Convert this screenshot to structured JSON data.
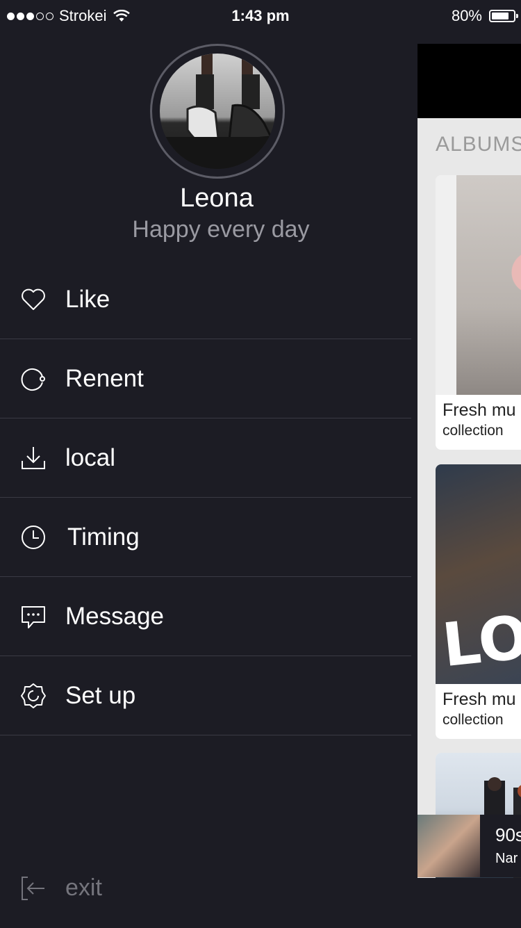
{
  "status_bar": {
    "carrier": "Strokei",
    "time": "1:43 pm",
    "battery_text": "80%",
    "battery_level": 0.8
  },
  "profile": {
    "name": "Leona",
    "status": "Happy every day"
  },
  "menu": {
    "items": [
      {
        "label": "Like",
        "icon": "heart-icon"
      },
      {
        "label": "Renent",
        "icon": "refresh-icon"
      },
      {
        "label": "local",
        "icon": "download-icon"
      },
      {
        "label": "Timing",
        "icon": "clock-icon"
      },
      {
        "label": "Message",
        "icon": "message-icon"
      },
      {
        "label": "Set up",
        "icon": "gear-icon"
      }
    ],
    "exit_label": "exit"
  },
  "panel": {
    "albums_title": "ALBUMS",
    "cards": [
      {
        "title": "Fresh mu",
        "subtitle": "collection"
      },
      {
        "title": "Fresh mu",
        "subtitle": "collection",
        "overlay_text": "LO"
      },
      {
        "title": "",
        "subtitle": ""
      }
    ],
    "player": {
      "title": "90s",
      "artist": "Nar"
    }
  },
  "colors": {
    "background": "#1c1c24",
    "divider": "#3a3a44",
    "muted_text": "#9a9aa2"
  }
}
